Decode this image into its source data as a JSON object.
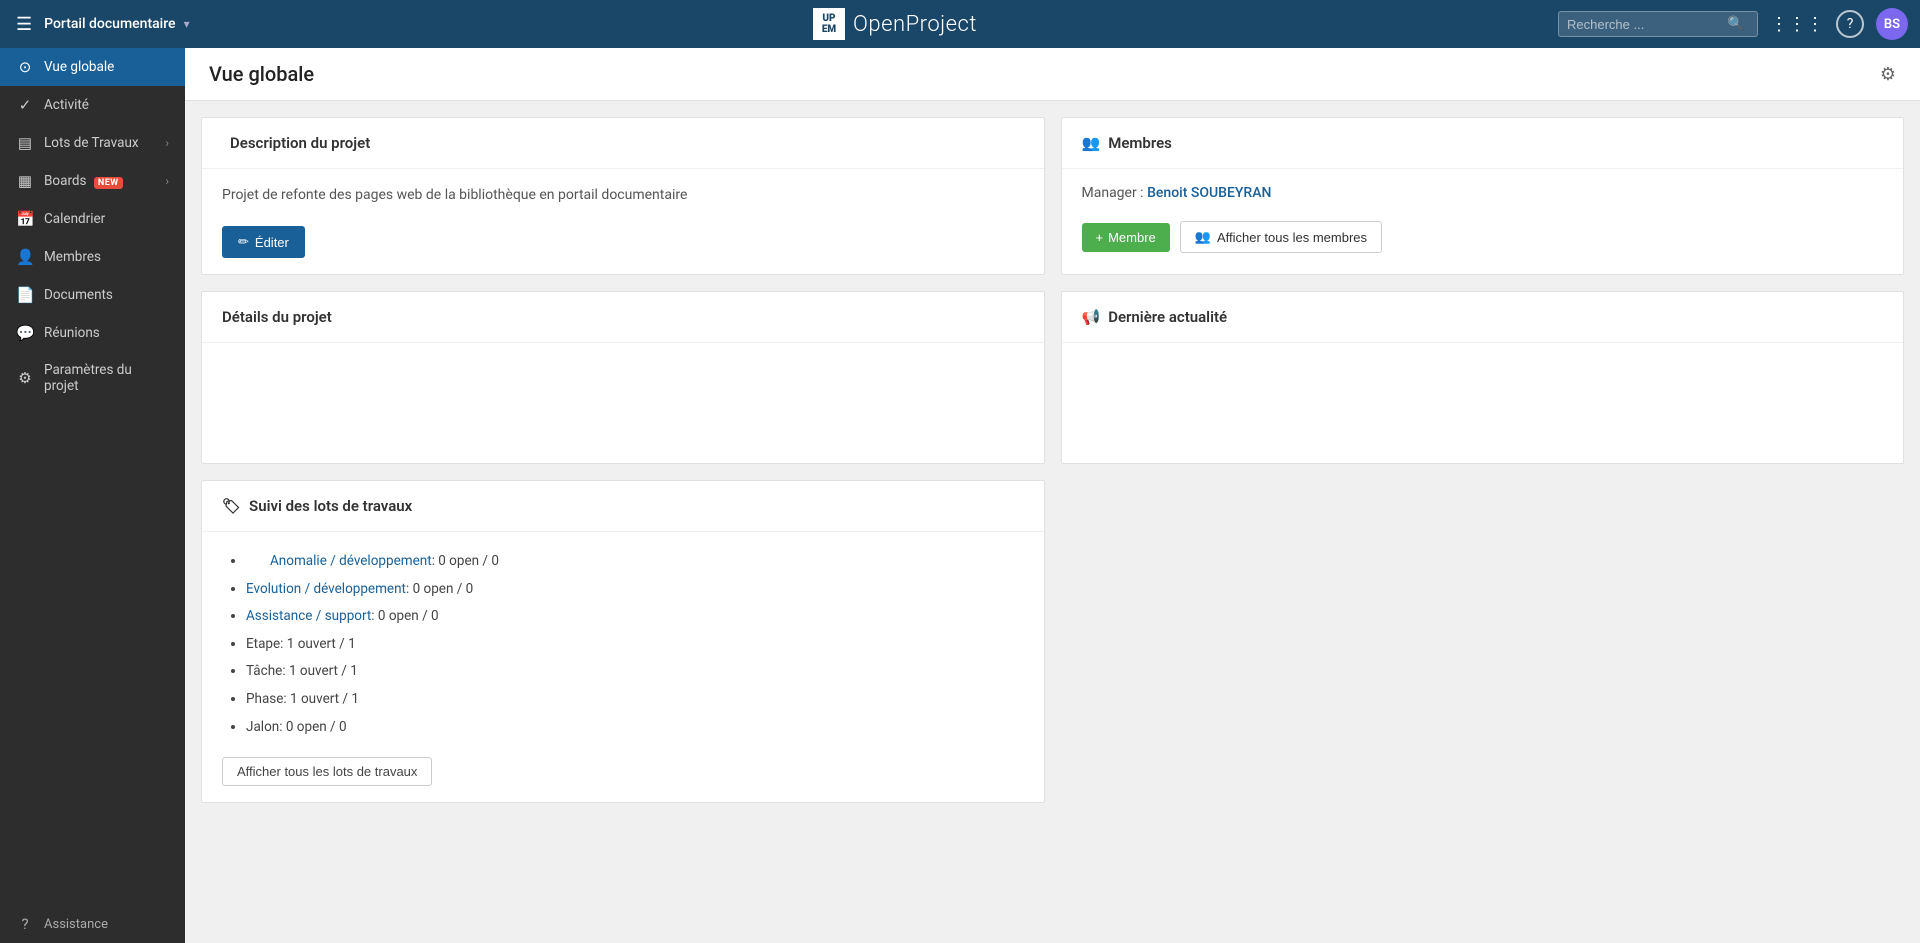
{
  "topnav": {
    "menu_icon": "☰",
    "project_name": "Portail documentaire",
    "project_chevron": "▾",
    "logo_line1": "UP",
    "logo_line2": "EM",
    "logo_text": "OpenProject",
    "search_placeholder": "Recherche ...",
    "grid_icon": "⋮⋮⋮",
    "help_icon": "?",
    "avatar_initials": "BS"
  },
  "sidebar": {
    "items": [
      {
        "id": "vue-globale",
        "icon": "⊙",
        "label": "Vue globale",
        "active": true
      },
      {
        "id": "activite",
        "icon": "✓",
        "label": "Activité",
        "active": false
      },
      {
        "id": "lots-travaux",
        "icon": "▤",
        "label": "Lots de Travaux",
        "active": false,
        "arrow": "›"
      },
      {
        "id": "boards",
        "icon": "▦",
        "label": "Boards",
        "badge": "NEW",
        "active": false,
        "arrow": "›"
      },
      {
        "id": "calendrier",
        "icon": "▦",
        "label": "Calendrier",
        "active": false
      },
      {
        "id": "membres",
        "icon": "👤",
        "label": "Membres",
        "active": false
      },
      {
        "id": "documents",
        "icon": "▭",
        "label": "Documents",
        "active": false
      },
      {
        "id": "reunions",
        "icon": "▭",
        "label": "Réunions",
        "active": false
      },
      {
        "id": "parametres",
        "icon": "⚙",
        "label": "Paramètres du projet",
        "active": false
      }
    ],
    "bottom_items": [
      {
        "id": "assistance",
        "icon": "?",
        "label": "Assistance"
      }
    ]
  },
  "main": {
    "title": "Vue globale",
    "description_card": {
      "title": "Description du projet",
      "body": "Projet de refonte des pages web de la bibliothèque en portail documentaire",
      "edit_button": "Éditer"
    },
    "membres_card": {
      "title": "Membres",
      "manager_label": "Manager :",
      "manager_name": "Benoit SOUBEYRAN",
      "add_button": "+ Membre",
      "show_button": "Afficher tous les membres"
    },
    "details_card": {
      "title": "Détails du projet"
    },
    "derniere_card": {
      "title": "Dernière actualité"
    },
    "suivi_card": {
      "title": "Suivi des lots de travaux",
      "items": [
        {
          "label": "Anomalie / développement",
          "link": true,
          "stats": ": 0 open / 0"
        },
        {
          "label": "Evolution / développement",
          "link": true,
          "stats": ": 0 open / 0"
        },
        {
          "label": "Assistance / support",
          "link": true,
          "stats": ": 0 open / 0"
        },
        {
          "label": "Etape",
          "link": false,
          "stats": ": 1 ouvert / 1"
        },
        {
          "label": "Tâche",
          "link": false,
          "stats": ": 1 ouvert / 1"
        },
        {
          "label": "Phase",
          "link": false,
          "stats": ": 1 ouvert / 1"
        },
        {
          "label": "Jalon",
          "link": false,
          "stats": ": 0 open / 0"
        }
      ],
      "show_button": "Afficher tous les lots de travaux"
    }
  }
}
